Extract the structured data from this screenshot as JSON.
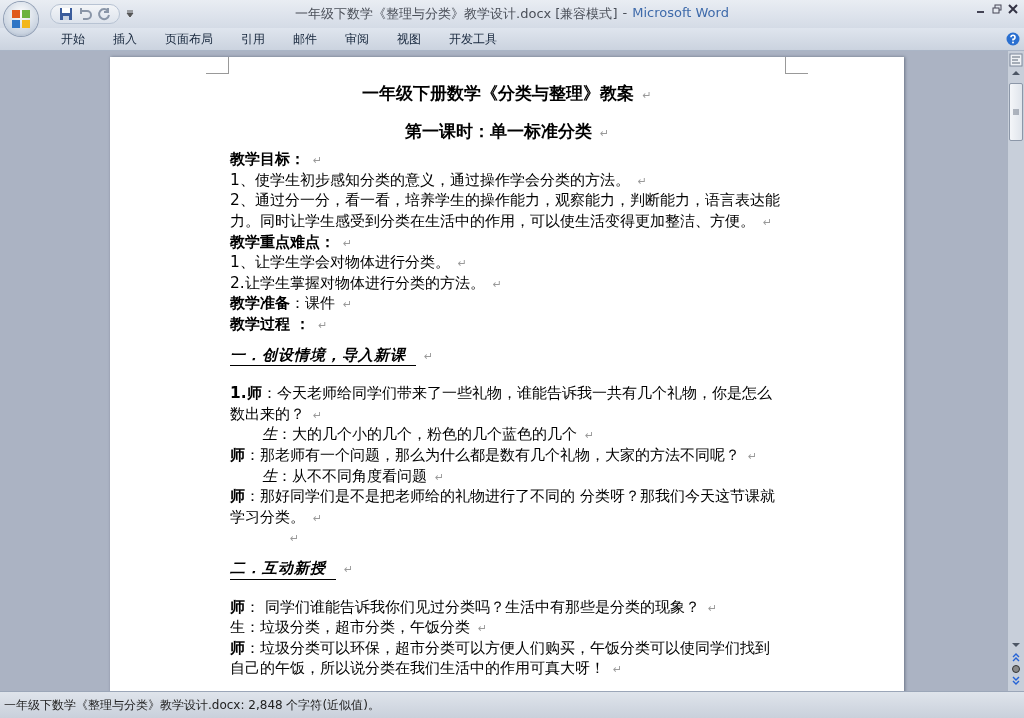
{
  "window": {
    "title": "一年级下数学《整理与分类》教学设计.docx [兼容模式]",
    "separator": "-",
    "app_name": "Microsoft Word"
  },
  "ribbon_tabs": [
    {
      "label": "开始",
      "selected": false
    },
    {
      "label": "插入",
      "selected": false
    },
    {
      "label": "页面布局",
      "selected": false
    },
    {
      "label": "引用",
      "selected": false
    },
    {
      "label": "邮件",
      "selected": false
    },
    {
      "label": "审阅",
      "selected": false
    },
    {
      "label": "视图",
      "selected": false
    },
    {
      "label": "开发工具",
      "selected": false
    }
  ],
  "document": {
    "paragraphs": [
      {
        "kind": "title",
        "text": "一年级下册数学《分类与整理》教案",
        "end_mark": "↵"
      },
      {
        "kind": "subtitle",
        "text": "第一课时：单一标准分类",
        "end_mark": "↵"
      },
      {
        "kind": "heading",
        "text": "教学目标：",
        "end_mark": "↵"
      },
      {
        "kind": "body",
        "text": "1、使学生初步感知分类的意义，通过操作学会分类的方法。",
        "end_mark": "↵"
      },
      {
        "kind": "body",
        "text": "2、通过分一分，看一看，培养学生的操作能力，观察能力，判断能力，语言表达能力。同时让学生感受到分类在生活中的作用，可以使生活变得更加整洁、方便。",
        "end_mark": "↵"
      },
      {
        "kind": "heading",
        "text": "教学重点难点：",
        "end_mark": "↵"
      },
      {
        "kind": "body",
        "text": "1、让学生学会对物体进行分类。",
        "end_mark": "↵"
      },
      {
        "kind": "body",
        "text": "2.让学生掌握对物体进行分类的方法。",
        "end_mark": "↵"
      },
      {
        "kind": "body",
        "text": "**教学准备**：课件",
        "end_mark": "↵"
      },
      {
        "kind": "heading",
        "text": "教学过程 ：",
        "end_mark": "↵"
      },
      {
        "kind": "section",
        "text": "一．创设情境，导入新课",
        "end_mark": "↵"
      },
      {
        "kind": "body",
        "text": "**1.师**：今天老师给同学们带来了一些礼物，谁能告诉我一共有几个礼物，你是怎么数出来的？",
        "end_mark": "↵"
      },
      {
        "kind": "student",
        "text": "*生*：大的几个小的几个，粉色的几个蓝色的几个",
        "end_mark": "↵"
      },
      {
        "kind": "body",
        "text": "**师**：那老师有一个问题，那么为什么都是数有几个礼物，大家的方法不同呢？",
        "end_mark": "↵"
      },
      {
        "kind": "student",
        "text": "*生*：从不不同角度看问题",
        "end_mark": "↵"
      },
      {
        "kind": "body",
        "text": "**师**：那好同学们是不是把老师给的礼物进行了不同的 分类呀？那我们今天这节课就学习分类。",
        "end_mark": "↵"
      },
      {
        "kind": "blank",
        "end_mark": "↵"
      },
      {
        "kind": "section",
        "text": "二．互动新授",
        "end_mark": "↵"
      },
      {
        "kind": "body",
        "text": "**师**： 同学们谁能告诉我你们见过分类吗？生活中有那些是分类的现象？",
        "end_mark": "↵"
      },
      {
        "kind": "body",
        "text": "生：垃圾分类，超市分类，午饭分类",
        "end_mark": "↵"
      },
      {
        "kind": "body",
        "text": "**师**：垃圾分类可以环保，超市分类可以方便人们购买，午饭分类可以使同学们找到自己的午饭，所以说分类在我们生活中的作用可真大呀！",
        "end_mark": "↵"
      }
    ]
  },
  "status_bar": {
    "text": "一年级下数学《整理与分类》教学设计.docx: 2,848 个字符(近似值)。"
  }
}
